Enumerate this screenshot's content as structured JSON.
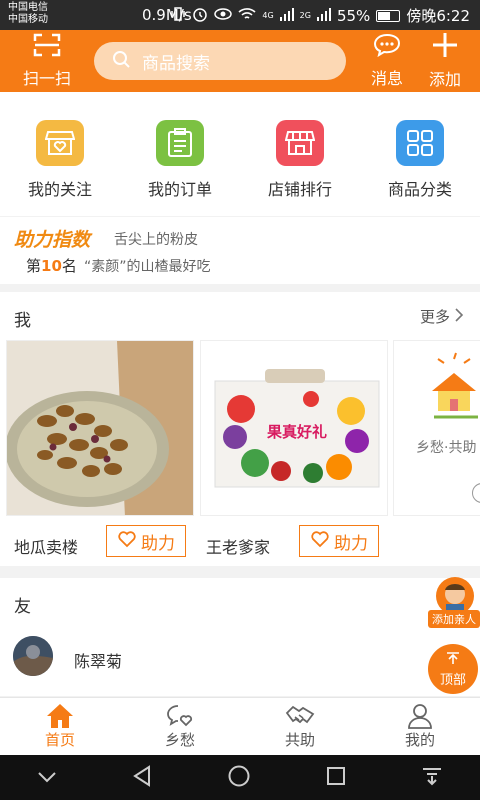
{
  "status_bar": {
    "carrier_1": "中国电信",
    "carrier_2": "中国移动",
    "speed": "0.9M/s",
    "network_1": "4G",
    "network_2": "2G",
    "battery": "55%",
    "time": "傍晚6:22"
  },
  "header": {
    "scan_label": "扫一扫",
    "search_placeholder": "商品搜索",
    "message_label": "消息",
    "add_label": "添加"
  },
  "quick_menu": [
    {
      "label": "我的关注",
      "icon": "shop-heart-icon",
      "color": "#f4b942"
    },
    {
      "label": "我的订单",
      "icon": "clipboard-icon",
      "color": "#7cc142"
    },
    {
      "label": "店铺排行",
      "icon": "store-icon",
      "color": "#f0505c"
    },
    {
      "label": "商品分类",
      "icon": "grid-icon",
      "color": "#3d9be9"
    }
  ],
  "ranking": {
    "title": "助力指数",
    "line1": "舌尖上的粉皮",
    "rank_prefix": "第",
    "rank_number": "10",
    "rank_suffix": "名",
    "line2": "“素颜”的山楂最好吃"
  },
  "me_section": {
    "title": "我",
    "more_label": "更多",
    "cards": [
      {
        "name": "地瓜卖楼",
        "help_label": "助力"
      },
      {
        "name": "王老爹家",
        "help_label": "助力",
        "box_text": "果真好礼"
      },
      {
        "promo_text": "乡愁·共助"
      }
    ]
  },
  "friend_section": {
    "title": "友",
    "friends": [
      {
        "name": "陈翠菊"
      }
    ]
  },
  "float_buttons": {
    "add_relative": "添加亲人",
    "top": "顶部"
  },
  "tabbar": [
    {
      "label": "首页",
      "icon": "home-icon",
      "active": true
    },
    {
      "label": "乡愁",
      "icon": "chat-heart-icon",
      "active": false
    },
    {
      "label": "共助",
      "icon": "handshake-icon",
      "active": false
    },
    {
      "label": "我的",
      "icon": "user-icon",
      "active": false
    }
  ],
  "colors": {
    "accent": "#f57b15",
    "search_bg": "#fcd8b4"
  }
}
